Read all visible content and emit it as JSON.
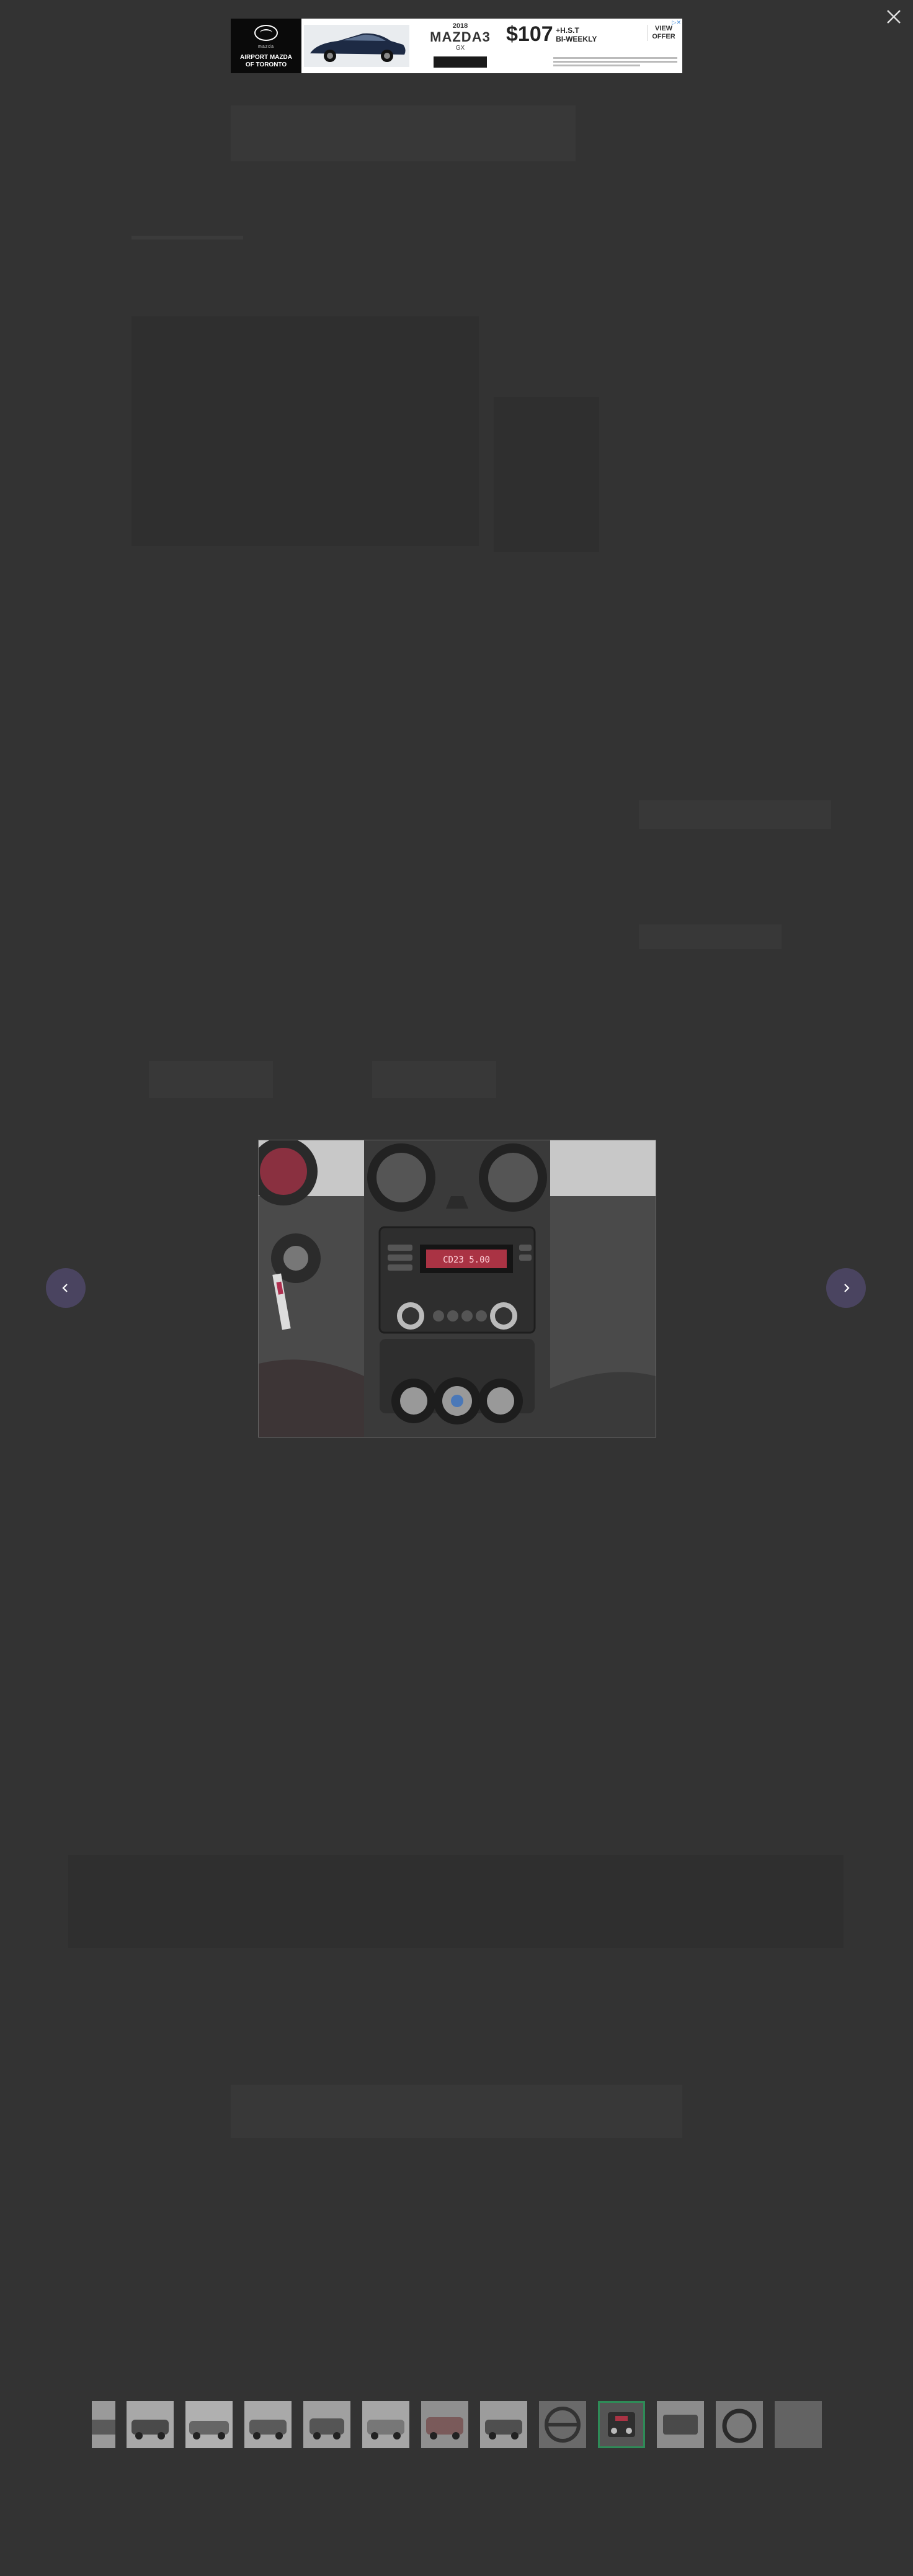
{
  "ad": {
    "brand_name": "mazda",
    "dealer_line1": "AIRPORT MAZDA",
    "dealer_line2": "OF TORONTO",
    "model_year": "2018",
    "model_name": "MAZDA3",
    "model_trim": "GX",
    "price": "$107",
    "price_note_line1": "+H.S.T",
    "price_note_line2": "BI-WEEKLY",
    "cta_line1": "VIEW",
    "cta_line2": "OFFER",
    "adchoices_icon": "ad-choices-icon"
  },
  "lightbox": {
    "close_icon": "close-icon",
    "prev_icon": "chevron-left-icon",
    "next_icon": "chevron-right-icon",
    "radio_display_text": "CD23 5.00",
    "thumbnail_count": 13,
    "active_thumbnail_index": 9
  },
  "colors": {
    "overlay_bg": "#333333",
    "nav_button": "#4a4460",
    "active_thumb_border": "#2e8b57"
  }
}
